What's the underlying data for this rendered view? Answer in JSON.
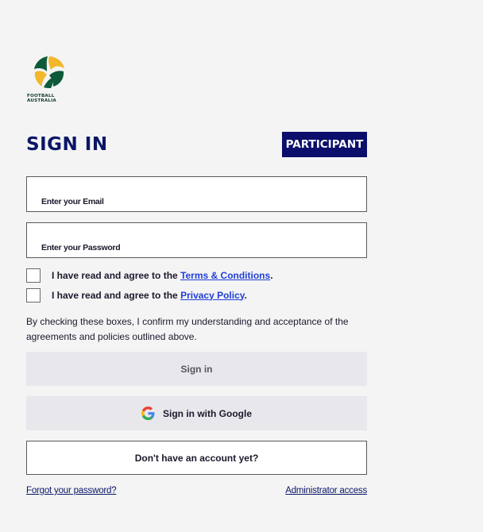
{
  "brand": {
    "logo_line1": "FOOTBALL",
    "logo_line2": "AUSTRALIA",
    "colors": {
      "navy": "#0b0f6b",
      "green": "#0d3a2f",
      "gold": "#f2b72a",
      "link": "#1f3fd8"
    }
  },
  "header": {
    "title": "SIGN IN",
    "role_badge": "PARTICIPANT"
  },
  "form": {
    "email": {
      "placeholder": "Enter your Email",
      "value": ""
    },
    "password": {
      "placeholder": "Enter your Password",
      "value": ""
    },
    "terms": {
      "prefix": "I have read and agree to the ",
      "link": "Terms & Conditions",
      "suffix": ".",
      "checked": false
    },
    "privacy": {
      "prefix": "I have read and agree to the ",
      "link": "Privacy Policy",
      "suffix": ".",
      "checked": false
    },
    "disclaimer": "By checking these boxes, I confirm my understanding and acceptance of the agreements and policies outlined above."
  },
  "actions": {
    "sign_in": "Sign in",
    "google": "Sign in with Google",
    "google_icon": "google-g-icon",
    "register": "Don't have an account yet?"
  },
  "footer": {
    "forgot": "Forgot your password?",
    "admin": "Administrator access"
  }
}
